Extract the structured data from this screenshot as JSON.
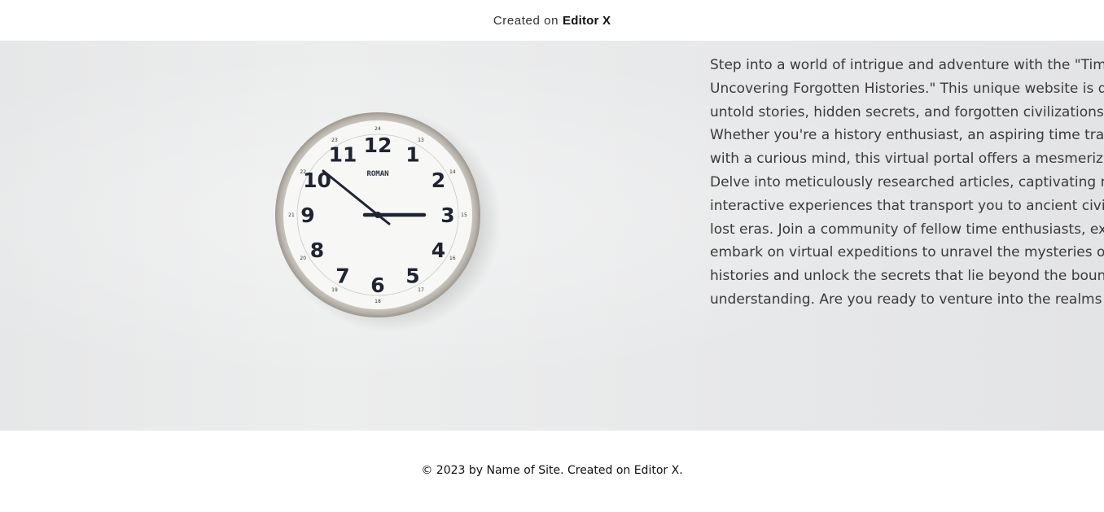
{
  "topbar": {
    "prefix": "Created on",
    "brand": "Editor X"
  },
  "hero": {
    "image": "wall-clock",
    "clock": {
      "brand": "ROMAN",
      "time": "10:15",
      "numerals": [
        "12",
        "1",
        "2",
        "3",
        "4",
        "5",
        "6",
        "7",
        "8",
        "9",
        "10",
        "11"
      ],
      "inner_numerals": [
        "13",
        "14",
        "15",
        "16",
        "17",
        "18",
        "19",
        "20",
        "21",
        "22",
        "23",
        "24"
      ]
    },
    "story_lines": [
      "Step into a world of intrigue and adventure with the \"Time Tr",
      "Uncovering Forgotten Histories.\" This unique website is dedi",
      "untold stories, hidden secrets, and forgotten civilizations thro",
      "Whether you're a history enthusiast, an aspiring time traveler,",
      "with a curious mind, this virtual portal offers a mesmerizing jo",
      "Delve into meticulously researched articles, captivating multi",
      "interactive experiences that transport you to ancient civilizatio",
      "lost eras. Join a community of fellow time enthusiasts, exchar",
      "embark on virtual expeditions to unravel the mysteries of the",
      "histories and unlock the secrets that lie beyond the boundari",
      "understanding. Are you ready to venture into the realms of th"
    ]
  },
  "footer": {
    "text": "© 2023 by Name of Site. Created on Editor X."
  }
}
